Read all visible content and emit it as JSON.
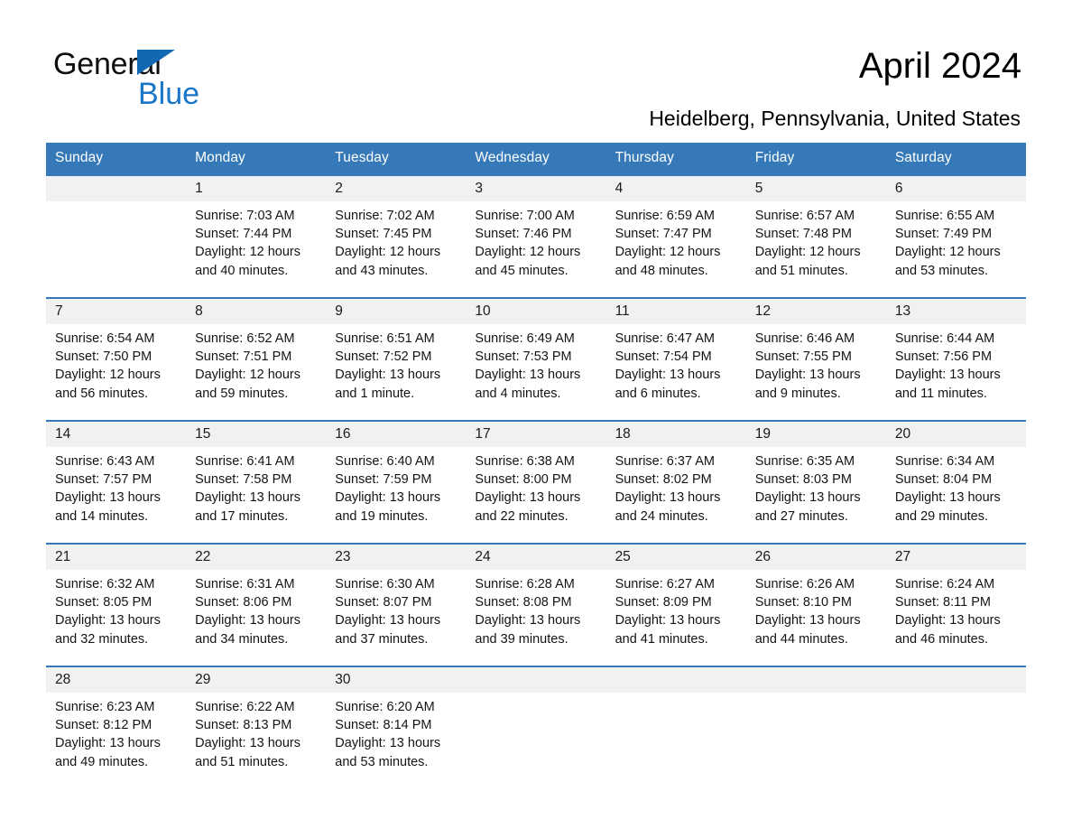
{
  "brand": {
    "name_line1": "General",
    "name_line2": "Blue",
    "accent_color": "#1976c8",
    "triangle_color": "#1268b3"
  },
  "header": {
    "title": "April 2024",
    "location": "Heidelberg, Pennsylvania, United States",
    "header_bg_color": "#3579b8",
    "daynum_bg_color": "#f1f1f1"
  },
  "weekday_headers": [
    "Sunday",
    "Monday",
    "Tuesday",
    "Wednesday",
    "Thursday",
    "Friday",
    "Saturday"
  ],
  "weeks": [
    {
      "days": [
        {
          "num": "",
          "l1": "",
          "l2": "",
          "l3": "",
          "l4": ""
        },
        {
          "num": "1",
          "l1": "Sunrise: 7:03 AM",
          "l2": "Sunset: 7:44 PM",
          "l3": "Daylight: 12 hours",
          "l4": "and 40 minutes."
        },
        {
          "num": "2",
          "l1": "Sunrise: 7:02 AM",
          "l2": "Sunset: 7:45 PM",
          "l3": "Daylight: 12 hours",
          "l4": "and 43 minutes."
        },
        {
          "num": "3",
          "l1": "Sunrise: 7:00 AM",
          "l2": "Sunset: 7:46 PM",
          "l3": "Daylight: 12 hours",
          "l4": "and 45 minutes."
        },
        {
          "num": "4",
          "l1": "Sunrise: 6:59 AM",
          "l2": "Sunset: 7:47 PM",
          "l3": "Daylight: 12 hours",
          "l4": "and 48 minutes."
        },
        {
          "num": "5",
          "l1": "Sunrise: 6:57 AM",
          "l2": "Sunset: 7:48 PM",
          "l3": "Daylight: 12 hours",
          "l4": "and 51 minutes."
        },
        {
          "num": "6",
          "l1": "Sunrise: 6:55 AM",
          "l2": "Sunset: 7:49 PM",
          "l3": "Daylight: 12 hours",
          "l4": "and 53 minutes."
        }
      ]
    },
    {
      "days": [
        {
          "num": "7",
          "l1": "Sunrise: 6:54 AM",
          "l2": "Sunset: 7:50 PM",
          "l3": "Daylight: 12 hours",
          "l4": "and 56 minutes."
        },
        {
          "num": "8",
          "l1": "Sunrise: 6:52 AM",
          "l2": "Sunset: 7:51 PM",
          "l3": "Daylight: 12 hours",
          "l4": "and 59 minutes."
        },
        {
          "num": "9",
          "l1": "Sunrise: 6:51 AM",
          "l2": "Sunset: 7:52 PM",
          "l3": "Daylight: 13 hours",
          "l4": "and 1 minute."
        },
        {
          "num": "10",
          "l1": "Sunrise: 6:49 AM",
          "l2": "Sunset: 7:53 PM",
          "l3": "Daylight: 13 hours",
          "l4": "and 4 minutes."
        },
        {
          "num": "11",
          "l1": "Sunrise: 6:47 AM",
          "l2": "Sunset: 7:54 PM",
          "l3": "Daylight: 13 hours",
          "l4": "and 6 minutes."
        },
        {
          "num": "12",
          "l1": "Sunrise: 6:46 AM",
          "l2": "Sunset: 7:55 PM",
          "l3": "Daylight: 13 hours",
          "l4": "and 9 minutes."
        },
        {
          "num": "13",
          "l1": "Sunrise: 6:44 AM",
          "l2": "Sunset: 7:56 PM",
          "l3": "Daylight: 13 hours",
          "l4": "and 11 minutes."
        }
      ]
    },
    {
      "days": [
        {
          "num": "14",
          "l1": "Sunrise: 6:43 AM",
          "l2": "Sunset: 7:57 PM",
          "l3": "Daylight: 13 hours",
          "l4": "and 14 minutes."
        },
        {
          "num": "15",
          "l1": "Sunrise: 6:41 AM",
          "l2": "Sunset: 7:58 PM",
          "l3": "Daylight: 13 hours",
          "l4": "and 17 minutes."
        },
        {
          "num": "16",
          "l1": "Sunrise: 6:40 AM",
          "l2": "Sunset: 7:59 PM",
          "l3": "Daylight: 13 hours",
          "l4": "and 19 minutes."
        },
        {
          "num": "17",
          "l1": "Sunrise: 6:38 AM",
          "l2": "Sunset: 8:00 PM",
          "l3": "Daylight: 13 hours",
          "l4": "and 22 minutes."
        },
        {
          "num": "18",
          "l1": "Sunrise: 6:37 AM",
          "l2": "Sunset: 8:02 PM",
          "l3": "Daylight: 13 hours",
          "l4": "and 24 minutes."
        },
        {
          "num": "19",
          "l1": "Sunrise: 6:35 AM",
          "l2": "Sunset: 8:03 PM",
          "l3": "Daylight: 13 hours",
          "l4": "and 27 minutes."
        },
        {
          "num": "20",
          "l1": "Sunrise: 6:34 AM",
          "l2": "Sunset: 8:04 PM",
          "l3": "Daylight: 13 hours",
          "l4": "and 29 minutes."
        }
      ]
    },
    {
      "days": [
        {
          "num": "21",
          "l1": "Sunrise: 6:32 AM",
          "l2": "Sunset: 8:05 PM",
          "l3": "Daylight: 13 hours",
          "l4": "and 32 minutes."
        },
        {
          "num": "22",
          "l1": "Sunrise: 6:31 AM",
          "l2": "Sunset: 8:06 PM",
          "l3": "Daylight: 13 hours",
          "l4": "and 34 minutes."
        },
        {
          "num": "23",
          "l1": "Sunrise: 6:30 AM",
          "l2": "Sunset: 8:07 PM",
          "l3": "Daylight: 13 hours",
          "l4": "and 37 minutes."
        },
        {
          "num": "24",
          "l1": "Sunrise: 6:28 AM",
          "l2": "Sunset: 8:08 PM",
          "l3": "Daylight: 13 hours",
          "l4": "and 39 minutes."
        },
        {
          "num": "25",
          "l1": "Sunrise: 6:27 AM",
          "l2": "Sunset: 8:09 PM",
          "l3": "Daylight: 13 hours",
          "l4": "and 41 minutes."
        },
        {
          "num": "26",
          "l1": "Sunrise: 6:26 AM",
          "l2": "Sunset: 8:10 PM",
          "l3": "Daylight: 13 hours",
          "l4": "and 44 minutes."
        },
        {
          "num": "27",
          "l1": "Sunrise: 6:24 AM",
          "l2": "Sunset: 8:11 PM",
          "l3": "Daylight: 13 hours",
          "l4": "and 46 minutes."
        }
      ]
    },
    {
      "days": [
        {
          "num": "28",
          "l1": "Sunrise: 6:23 AM",
          "l2": "Sunset: 8:12 PM",
          "l3": "Daylight: 13 hours",
          "l4": "and 49 minutes."
        },
        {
          "num": "29",
          "l1": "Sunrise: 6:22 AM",
          "l2": "Sunset: 8:13 PM",
          "l3": "Daylight: 13 hours",
          "l4": "and 51 minutes."
        },
        {
          "num": "30",
          "l1": "Sunrise: 6:20 AM",
          "l2": "Sunset: 8:14 PM",
          "l3": "Daylight: 13 hours",
          "l4": "and 53 minutes."
        },
        {
          "num": "",
          "l1": "",
          "l2": "",
          "l3": "",
          "l4": ""
        },
        {
          "num": "",
          "l1": "",
          "l2": "",
          "l3": "",
          "l4": ""
        },
        {
          "num": "",
          "l1": "",
          "l2": "",
          "l3": "",
          "l4": ""
        },
        {
          "num": "",
          "l1": "",
          "l2": "",
          "l3": "",
          "l4": ""
        }
      ]
    }
  ]
}
